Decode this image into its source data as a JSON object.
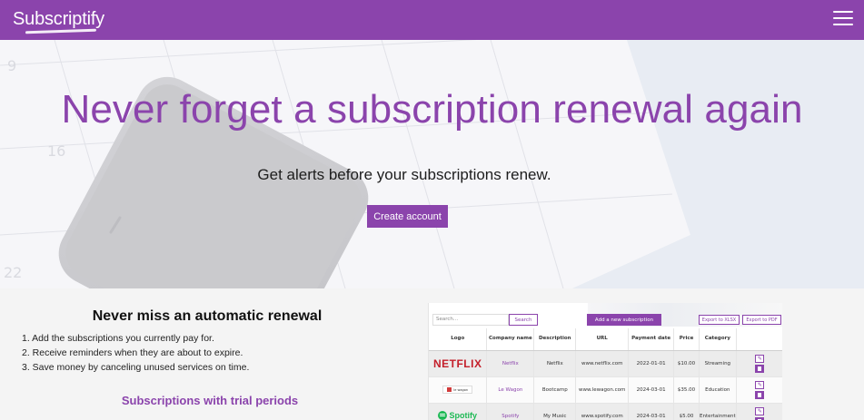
{
  "navbar": {
    "brand": "Subscriptify",
    "menu_icon": "hamburger-menu-icon"
  },
  "hero": {
    "title": "Never forget a subscription renewal again",
    "subtitle": "Get alerts before your subscriptions renew.",
    "cta_label": "Create account",
    "background": "calendar-and-phone-photo"
  },
  "features": {
    "title": "Never miss an automatic renewal",
    "steps": [
      "1. Add the subscriptions you currently pay for.",
      "2. Receive reminders when they are about to expire.",
      "3. Save money by canceling unused services on time."
    ],
    "trial_title": "Subscriptions with trial periods"
  },
  "preview": {
    "search_placeholder": "Search...",
    "search_button": "Search",
    "add_button": "Add a new subscription",
    "export_xlsx": "Export to XLSX",
    "export_pdf": "Export to PDF",
    "columns": [
      "Logo",
      "Company name",
      "Description",
      "URL",
      "Payment date",
      "Price",
      "Category",
      ""
    ],
    "rows": [
      {
        "logo": "NETFLIX",
        "company": "Netflix",
        "description": "Netflix",
        "url": "www.netflix.com",
        "payment_date": "2022-01-01",
        "price": "$10.00",
        "category": "Streaming"
      },
      {
        "logo": "le wagon",
        "company": "Le Wagon",
        "description": "Bootcamp",
        "url": "www.lewagon.com",
        "payment_date": "2024-03-01",
        "price": "$35.00",
        "category": "Education"
      },
      {
        "logo": "Spotify",
        "company": "Spotify",
        "description": "My Music",
        "url": "www.spotify.com",
        "payment_date": "2024-03-01",
        "price": "$5.00",
        "category": "Entertainment"
      }
    ]
  },
  "colors": {
    "brand": "#8b44ac",
    "netflix": "#c4202b",
    "spotify": "#1db954"
  }
}
